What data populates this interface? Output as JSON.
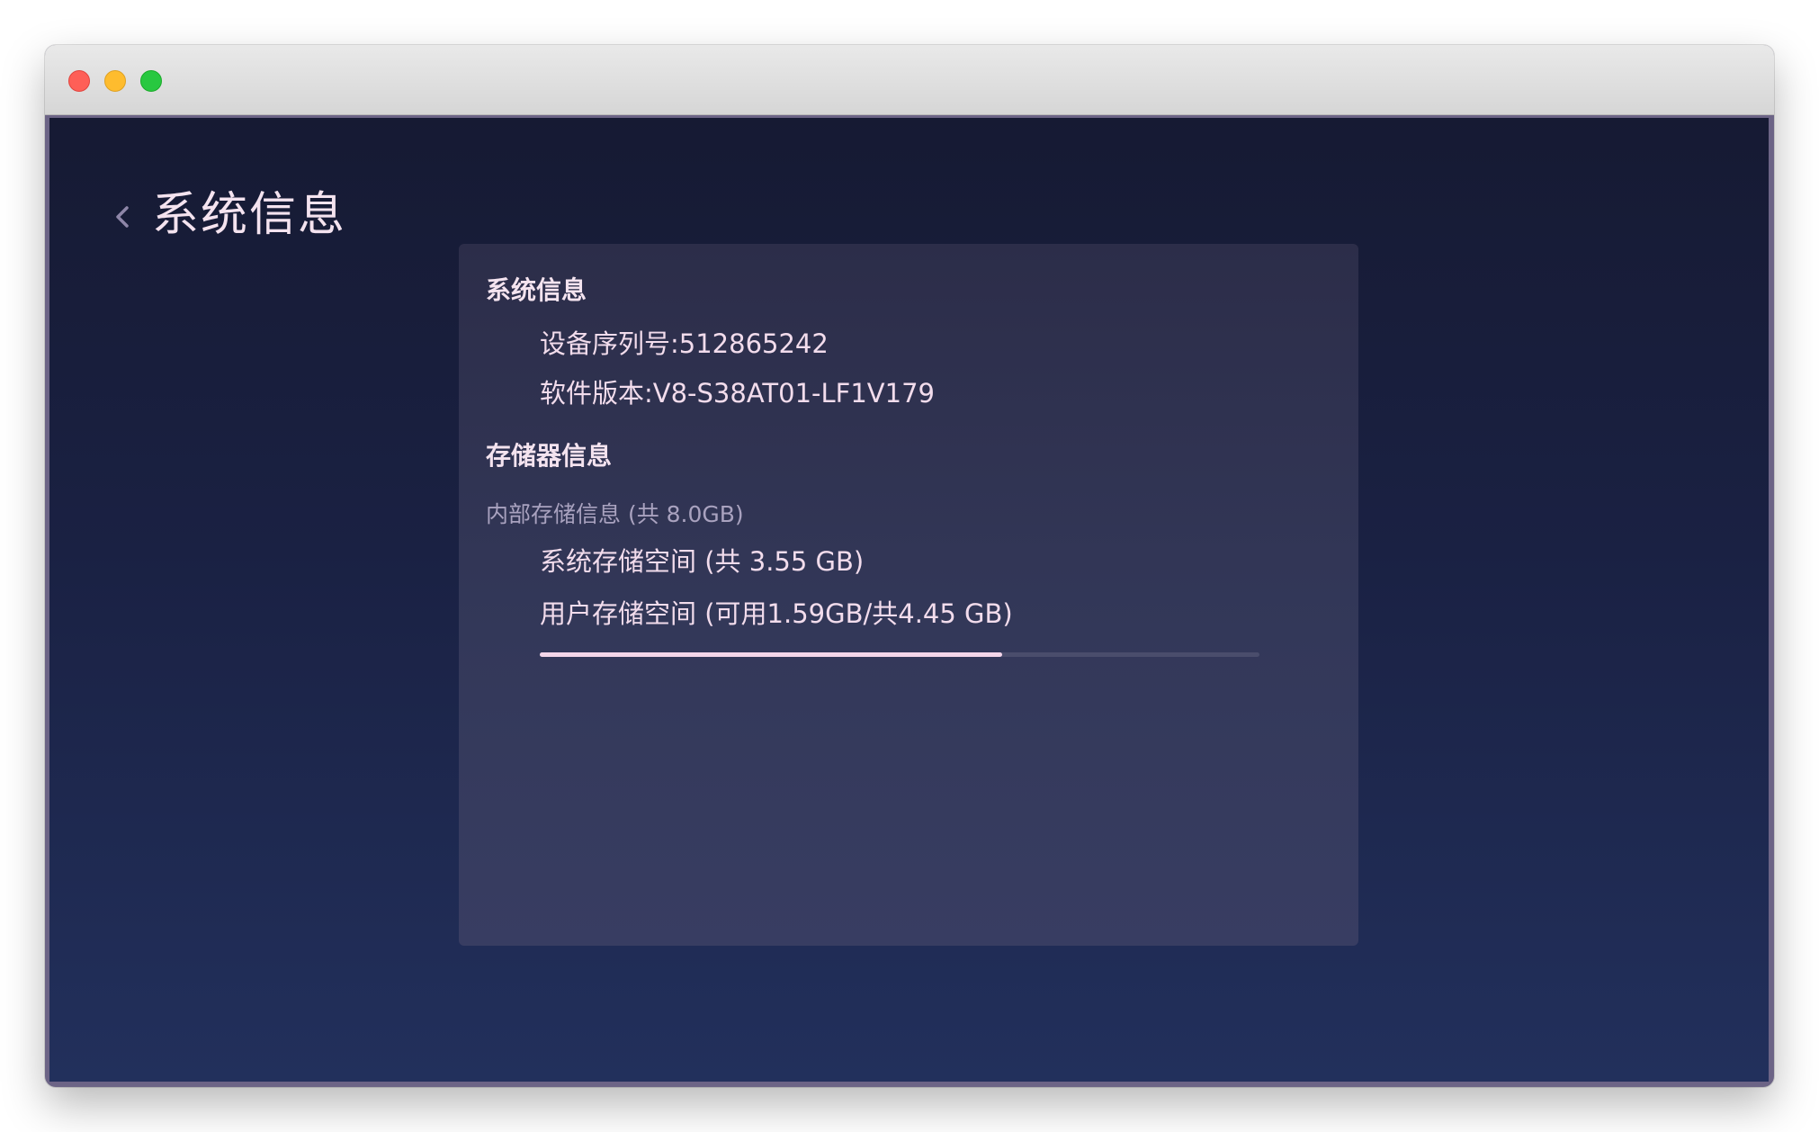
{
  "window": {
    "traffic_lights": [
      "close",
      "minimize",
      "maximize"
    ]
  },
  "header": {
    "back_icon": "chevron-left-icon",
    "title": "系统信息"
  },
  "panel": {
    "system_section": {
      "title": "系统信息",
      "serial": "设备序列号:512865242",
      "software_version": "软件版本:V8-S38AT01-LF1V179"
    },
    "storage_section": {
      "title": "存储器信息",
      "internal_label": "内部存储信息 (共 8.0GB)",
      "system_storage": "系统存储空间 (共 3.55 GB)",
      "user_storage": "用户存储空间 (可用1.59GB/共4.45 GB)",
      "user_storage_used_fraction": 0.643
    }
  },
  "colors": {
    "background_top": "#161a33",
    "background_bottom": "#22305c",
    "panel": "#333859",
    "text": "#f2dcec",
    "muted_text": "#a9a2bf",
    "progress_fill": "#f4d6ea",
    "progress_track": "#4a4d6c"
  }
}
